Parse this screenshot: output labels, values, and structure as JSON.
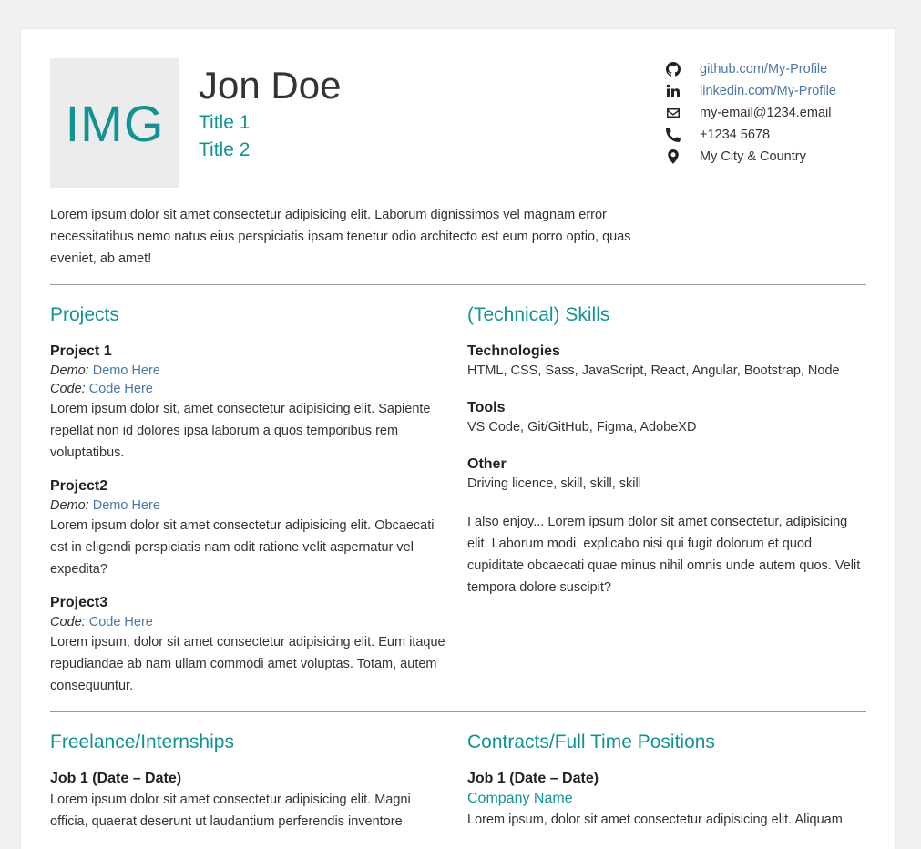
{
  "header": {
    "avatar_text": "IMG",
    "name": "Jon Doe",
    "title1": "Title 1",
    "title2": "Title 2"
  },
  "contacts": {
    "github": "github.com/My-Profile",
    "linkedin": "linkedin.com/My-Profile",
    "email": "my-email@1234.email",
    "phone": "+1234 5678",
    "location": "My City & Country"
  },
  "intro": "Lorem ipsum dolor sit amet consectetur adipisicing elit. Laborum dignissimos vel magnam error necessitatibus nemo natus eius perspiciatis ipsam tenetur odio architecto est eum porro optio, quas eveniet, ab amet!",
  "projects": {
    "heading": "Projects",
    "p1": {
      "title": "Project 1",
      "demo_label": "Demo:",
      "demo_link": "Demo Here",
      "code_label": "Code:",
      "code_link": "Code Here",
      "desc": "Lorem ipsum dolor sit, amet consectetur adipisicing elit. Sapiente repellat non id dolores ipsa laborum a quos temporibus rem voluptatibus."
    },
    "p2": {
      "title": "Project2",
      "demo_label": "Demo:",
      "demo_link": "Demo Here",
      "desc": "Lorem ipsum dolor sit amet consectetur adipisicing elit. Obcaecati est in eligendi perspiciatis nam odit ratione velit aspernatur vel expedita?"
    },
    "p3": {
      "title": "Project3",
      "code_label": "Code:",
      "code_link": "Code Here",
      "desc": "Lorem ipsum, dolor sit amet consectetur adipisicing elit. Eum itaque repudiandae ab nam ullam commodi amet voluptas. Totam, autem consequuntur."
    }
  },
  "skills": {
    "heading": "(Technical) Skills",
    "tech_title": "Technologies",
    "tech_value": "HTML, CSS, Sass, JavaScript, React, Angular, Bootstrap, Node",
    "tools_title": "Tools",
    "tools_value": "VS Code, Git/GitHub, Figma, AdobeXD",
    "other_title": "Other",
    "other_value": "Driving licence, skill, skill, skill",
    "enjoy": "I also enjoy... Lorem ipsum dolor sit amet consectetur, adipisicing elit. Laborum modi, explicabo nisi qui fugit dolorum et quod cupiditate obcaecati quae minus nihil omnis unde autem quos. Velit tempora dolore suscipit?"
  },
  "freelance": {
    "heading": "Freelance/Internships",
    "job1_title": "Job 1 (Date – Date)",
    "job1_desc": "Lorem ipsum dolor sit amet consectetur adipisicing elit. Magni officia, quaerat deserunt ut laudantium perferendis inventore"
  },
  "contracts": {
    "heading": "Contracts/Full Time Positions",
    "job1_title": "Job 1 (Date – Date)",
    "company": "Company Name",
    "job1_desc": "Lorem ipsum, dolor sit amet consectetur adipisicing elit. Aliquam"
  }
}
